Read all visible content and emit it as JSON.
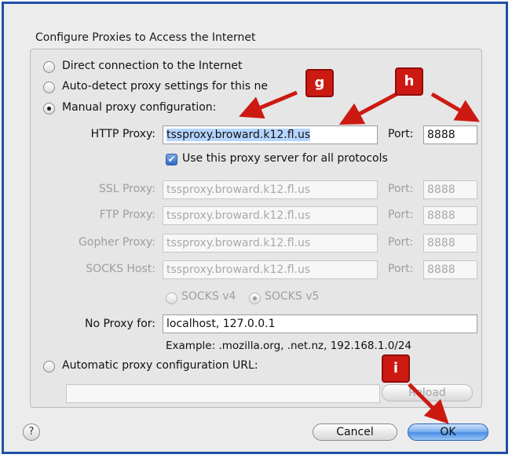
{
  "dialog": {
    "group_title": "Configure Proxies to Access the Internet",
    "options": {
      "direct": "Direct connection to the Internet",
      "autodetect": "Auto-detect proxy settings for this ne",
      "manual": "Manual proxy configuration:",
      "auto_url": "Automatic proxy configuration URL:"
    },
    "selected_option": "manual",
    "proxies": [
      {
        "label": "HTTP Proxy:",
        "host": "tssproxy.broward.k12.fl.us",
        "port": "8888"
      },
      {
        "label": "SSL Proxy:",
        "host": "tssproxy.broward.k12.fl.us",
        "port": "8888"
      },
      {
        "label": "FTP Proxy:",
        "host": "tssproxy.broward.k12.fl.us",
        "port": "8888"
      },
      {
        "label": "Gopher Proxy:",
        "host": "tssproxy.broward.k12.fl.us",
        "port": "8888"
      },
      {
        "label": "SOCKS Host:",
        "host": "tssproxy.broward.k12.fl.us",
        "port": "8888"
      }
    ],
    "port_label": "Port:",
    "use_for_all": {
      "label": "Use this proxy server for all protocols",
      "checked": true
    },
    "socks": {
      "v4": "SOCKS v4",
      "v5": "SOCKS v5",
      "selected": "v5"
    },
    "no_proxy": {
      "label": "No Proxy for:",
      "value": "localhost, 127.0.0.1"
    },
    "example": "Example: .mozilla.org, .net.nz, 192.168.1.0/24",
    "auto_url_value": "",
    "reload_label": "Reload",
    "help_label": "?",
    "cancel_label": "Cancel",
    "ok_label": "OK"
  },
  "annotations": {
    "g": "g",
    "h": "h",
    "i": "i",
    "color": "#cc1a12"
  },
  "colors": {
    "frame": "#1f4fa8",
    "selection": "#b5d5ff",
    "ok_button": "#4a8ee6"
  }
}
